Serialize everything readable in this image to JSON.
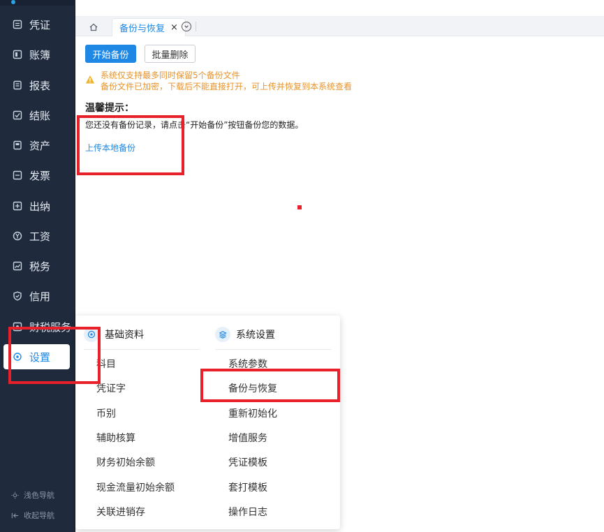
{
  "sidebar": {
    "items": [
      {
        "label": "凭证",
        "icon": "voucher-icon"
      },
      {
        "label": "账簿",
        "icon": "ledger-icon"
      },
      {
        "label": "报表",
        "icon": "report-icon"
      },
      {
        "label": "结账",
        "icon": "closing-icon"
      },
      {
        "label": "资产",
        "icon": "asset-icon"
      },
      {
        "label": "发票",
        "icon": "invoice-icon"
      },
      {
        "label": "出纳",
        "icon": "cashier-icon"
      },
      {
        "label": "工资",
        "icon": "yen-icon"
      },
      {
        "label": "税务",
        "icon": "tax-icon"
      },
      {
        "label": "信用",
        "icon": "shield-icon"
      },
      {
        "label": "财税服务",
        "icon": "service-icon"
      },
      {
        "label": "设置",
        "icon": "gear-icon"
      }
    ],
    "bottom": {
      "theme_label": "浅色导航",
      "collapse_label": "收起导航"
    }
  },
  "tabs": {
    "active_label": "备份与恢复",
    "close_glyph": "×"
  },
  "toolbar": {
    "start_backup": "开始备份",
    "batch_delete": "批量删除"
  },
  "notice": {
    "line1": "系统仅支持最多同时保留5个备份文件",
    "line2": "备份文件已加密，下载后不能直接打开，可上传并恢复到本系统查看"
  },
  "tips": {
    "title": "温馨提示：",
    "body": "您还没有备份记录，请点击“开始备份”按钮备份您的数据。",
    "upload_link": "上传本地备份"
  },
  "settings_menu": {
    "basic": {
      "title": "基础资料",
      "items": [
        "科目",
        "凭证字",
        "币别",
        "辅助核算",
        "财务初始余额",
        "现金流量初始余额",
        "关联进销存"
      ]
    },
    "system": {
      "title": "系统设置",
      "items": [
        "系统参数",
        "备份与恢复",
        "重新初始化",
        "增值服务",
        "凭证模板",
        "套打模板",
        "操作日志"
      ]
    }
  },
  "colors": {
    "sidebar_bg": "#1f2a3c",
    "accent": "#1f88e5",
    "warning": "#e8932b",
    "highlight": "#e8202a"
  }
}
